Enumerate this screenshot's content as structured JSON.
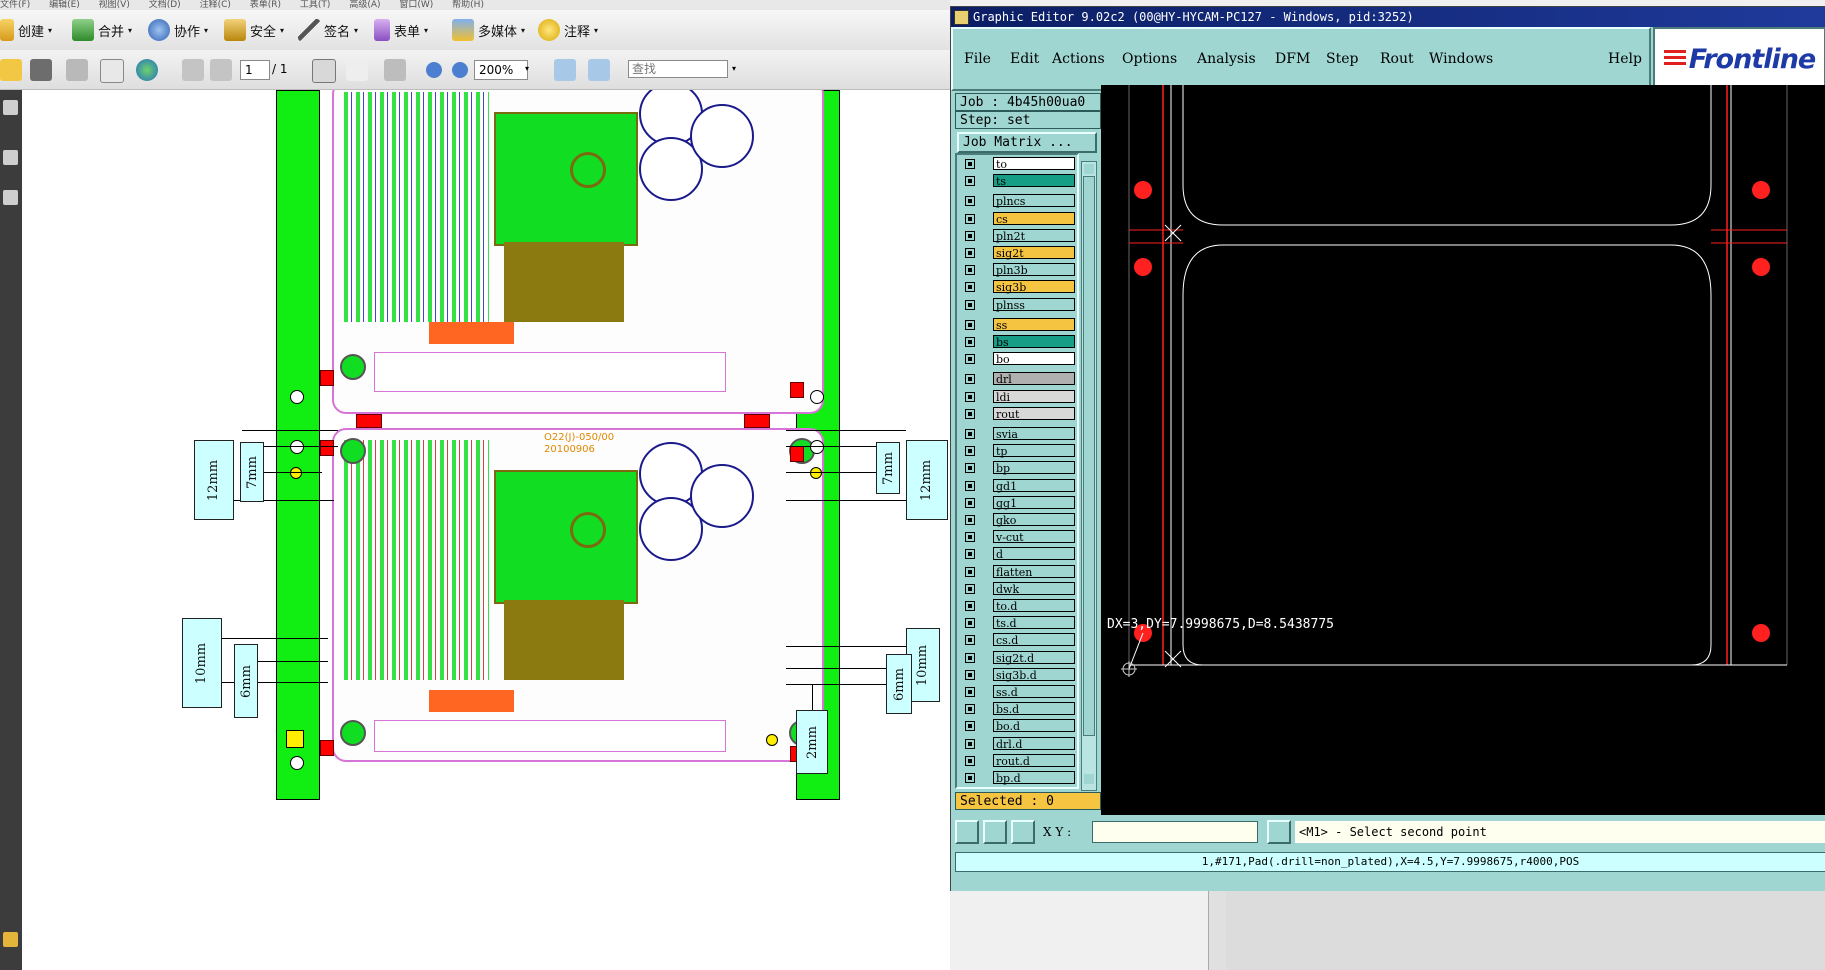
{
  "pdf": {
    "menubar": [
      "文件(F)",
      "编辑(E)",
      "视图(V)",
      "文档(D)",
      "注释(C)",
      "表单(R)",
      "工具(T)",
      "高级(A)",
      "窗口(W)",
      "帮助(H)"
    ],
    "toolbar": {
      "create": "创建",
      "combine": "合并",
      "collaborate": "协作",
      "secure": "安全",
      "sign": "签名",
      "forms": "表单",
      "multimedia": "多媒体",
      "comment": "注释"
    },
    "nav": {
      "page_current": "1",
      "page_total": "/ 1",
      "zoom": "200%",
      "search_placeholder": "查找"
    },
    "drawing": {
      "board_label": "O22(J)-050/00",
      "board_date": "20100906",
      "dims_left": [
        "12mm",
        "7mm",
        "10mm",
        "6mm"
      ],
      "dims_right": [
        "7mm",
        "12mm",
        "10mm",
        "6mm"
      ],
      "dim_bottom": "2mm"
    }
  },
  "ge": {
    "title": "Graphic Editor 9.02c2 (00@HY-HYCAM-PC127 - Windows, pid:3252)",
    "menu": [
      "File",
      "Edit",
      "Actions",
      "Options",
      "Analysis",
      "DFM",
      "Step",
      "Rout",
      "Windows"
    ],
    "help": "Help",
    "logo": "Frontline",
    "job_label": "Job : 4b45h00ua0",
    "step_label": "Step: set",
    "job_matrix_button": "Job Matrix ...",
    "selected_label": "Selected : 0",
    "layers": [
      {
        "name": "to",
        "color": "#ffffff"
      },
      {
        "name": "ts",
        "color": "#169e86"
      },
      {
        "name": "plncs",
        "color": "#9fd6d2"
      },
      {
        "name": "cs",
        "color": "#f5c542"
      },
      {
        "name": "pln2t",
        "color": "#9fd6d2"
      },
      {
        "name": "sig2t",
        "color": "#f5c542"
      },
      {
        "name": "pln3b",
        "color": "#9fd6d2"
      },
      {
        "name": "sig3b",
        "color": "#f5c542"
      },
      {
        "name": "plnss",
        "color": "#9fd6d2"
      },
      {
        "name": "ss",
        "color": "#f5c542"
      },
      {
        "name": "bs",
        "color": "#169e86"
      },
      {
        "name": "bo",
        "color": "#ffffff"
      },
      {
        "name": "drl",
        "color": "#b0b0b0"
      },
      {
        "name": "ldi",
        "color": "#d8d8d8"
      },
      {
        "name": "rout",
        "color": "#d8d8d8"
      },
      {
        "name": "svia",
        "color": "#9fd6d2"
      },
      {
        "name": "tp",
        "color": "#9fd6d2"
      },
      {
        "name": "bp",
        "color": "#9fd6d2"
      },
      {
        "name": "gd1",
        "color": "#9fd6d2"
      },
      {
        "name": "gg1",
        "color": "#9fd6d2"
      },
      {
        "name": "gko",
        "color": "#9fd6d2"
      },
      {
        "name": "v-cut",
        "color": "#9fd6d2"
      },
      {
        "name": "d",
        "color": "#9fd6d2"
      },
      {
        "name": "flatten",
        "color": "#9fd6d2"
      },
      {
        "name": "dwk",
        "color": "#9fd6d2"
      },
      {
        "name": "to.d",
        "color": "#9fd6d2"
      },
      {
        "name": "ts.d",
        "color": "#9fd6d2"
      },
      {
        "name": "cs.d",
        "color": "#9fd6d2"
      },
      {
        "name": "sig2t.d",
        "color": "#9fd6d2"
      },
      {
        "name": "sig3b.d",
        "color": "#9fd6d2"
      },
      {
        "name": "ss.d",
        "color": "#9fd6d2"
      },
      {
        "name": "bs.d",
        "color": "#9fd6d2"
      },
      {
        "name": "bo.d",
        "color": "#9fd6d2"
      },
      {
        "name": "drl.d",
        "color": "#9fd6d2"
      },
      {
        "name": "rout.d",
        "color": "#9fd6d2"
      },
      {
        "name": "bp.d",
        "color": "#9fd6d2"
      }
    ],
    "measure_readout": "DX=3,DY=7.9998675,D=8.5438775",
    "xy_label": "X Y :",
    "prompt": "<M1> - Select second point",
    "status": "1,#171,Pad(.drill=non_plated),X=4.5,Y=7.9998675,r4000,POS"
  }
}
